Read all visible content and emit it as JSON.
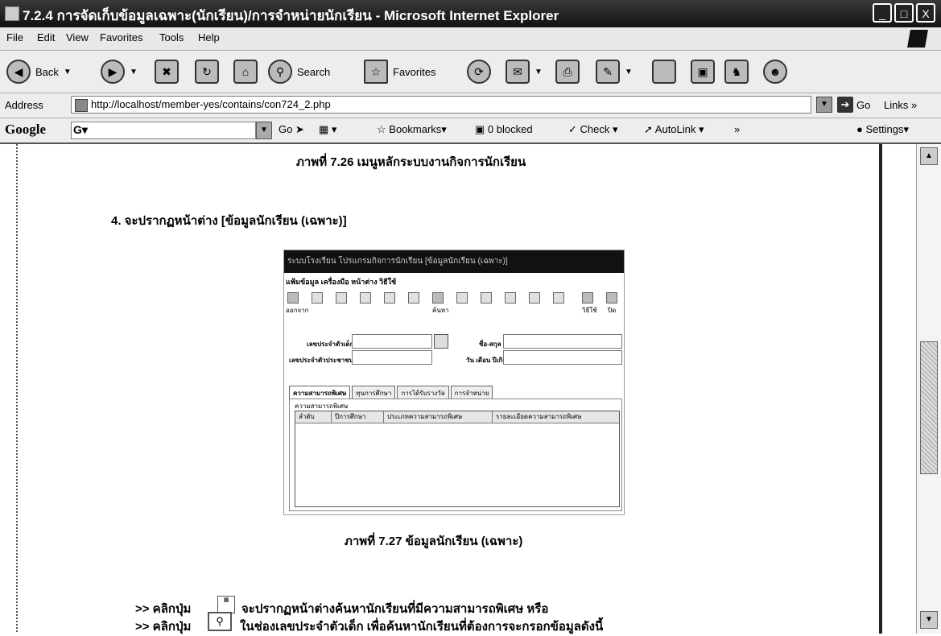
{
  "window": {
    "title": "7.2.4 การจัดเก็บข้อมูลเฉพาะ(นักเรียน)/การจำหน่ายนักเรียน - Microsoft Internet Explorer",
    "buttons": [
      "_",
      "□",
      "X"
    ]
  },
  "menu": [
    "File",
    "Edit",
    "View",
    "Favorites",
    "Tools",
    "Help"
  ],
  "toolbar": {
    "back": "Back",
    "search": "Search",
    "favorites": "Favorites"
  },
  "address": {
    "label": "Address",
    "url": "http://localhost/member-yes/contains/con724_2.php",
    "go": "Go",
    "links": "Links",
    "links_more": "»"
  },
  "google_bar": {
    "logo": "Google",
    "go": "Go",
    "bookmarks": "Bookmarks▾",
    "blocked": "0 blocked",
    "check": "Check",
    "autolink": "AutoLink",
    "more": "»",
    "settings": "Settings▾"
  },
  "content": {
    "caption_726": "ภาพที่ 7.26  เมนูหลักระบบงานกิจการนักเรียน",
    "step4": "4. จะปรากฏหน้าต่าง [ข้อมูลนักเรียน (เฉพาะ)]",
    "caption_727": "ภาพที่ 7.27  ข้อมูลนักเรียน (เฉพาะ)",
    "instr1_prefix": ">> คลิกปุ่ม",
    "instr1_text": "จะปรากฏหน้าต่างค้นหานักเรียนที่มีความสามารถพิเศษ หรือ",
    "instr2_prefix": ">> คลิกปุ่ม",
    "instr2_text": "ในช่องเลขประจำตัวเด็ก เพื่อค้นหานักเรียนที่ต้องการจะกรอกข้อมูลดังนี้"
  },
  "embedded": {
    "title": "ระบบโรงเรียน โปรแกรมกิจการนักเรียน [ข้อมูลนักเรียน (เฉพาะ)]",
    "menu": "แฟ้มข้อมูล  เครื่องมือ  หน้าต่าง  วิธีใช้",
    "icon_first_label": "ออกจาก",
    "icon_search_label": "ค้นหา",
    "icon_help_label": "วิธีใช้",
    "icon_exit_label": "ปิด",
    "field1_label": "เลขประจำตัวเด็ก",
    "field2_label": "ชื่อ-สกุล",
    "field3_label": "เลขประจำตัวประชาชน",
    "field4_label": "วัน เดือน ปีเกิด",
    "tabs": [
      "ความสามารถพิเศษ",
      "ทุนการศึกษา",
      "การได้รับรางวัล",
      "การจำหน่าย"
    ],
    "group_label": "ความสามารถพิเศษ",
    "grid_columns": [
      "ลำดับ",
      "ปีการศึกษา",
      "ประเภทความสามารถพิเศษ",
      "รายละเอียดความสามารถพิเศษ"
    ]
  }
}
